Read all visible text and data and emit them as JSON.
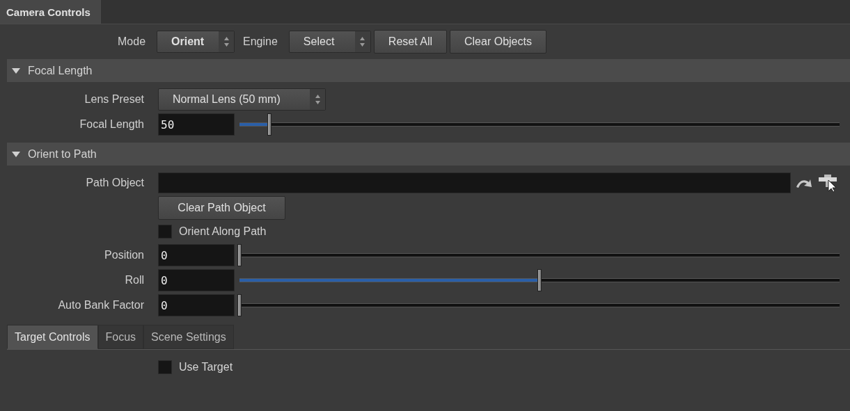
{
  "panel_tab": {
    "label": "Camera Controls",
    "selected": true
  },
  "toolbar": {
    "mode": {
      "label": "Mode",
      "value": "Orient"
    },
    "engine": {
      "label": "Engine",
      "value": "Select"
    },
    "buttons": [
      "Reset All",
      "Clear Objects"
    ]
  },
  "sections": [
    {
      "title": "Focal Length",
      "expanded": true,
      "rows": [
        {
          "kind": "dropdown",
          "label": "Lens Preset",
          "value": "Normal Lens (50 mm)"
        },
        {
          "kind": "slider",
          "label": "Focal Length",
          "value": "50",
          "level": 0.05
        }
      ]
    },
    {
      "title": "Orient to Path",
      "expanded": true,
      "rows": [
        {
          "kind": "object",
          "label": "Path Object"
        },
        {
          "kind": "button",
          "label": "Clear Path Object"
        },
        {
          "kind": "checkbox",
          "label": "Orient Along Path",
          "checked": false
        },
        {
          "kind": "slider",
          "label": "Position",
          "value": "0",
          "level": 0
        },
        {
          "kind": "slider",
          "label": "Roll",
          "value": "0",
          "level": 0.5
        },
        {
          "kind": "slider",
          "label": "Auto Bank Factor",
          "value": "0",
          "level": 0
        }
      ]
    }
  ],
  "tabs": [
    {
      "label": "Target Controls",
      "selected": true
    },
    {
      "label": "Focus",
      "selected": false
    },
    {
      "label": "Scene Settings",
      "selected": false
    }
  ],
  "tab_content": [
    {
      "kind": "checkbox",
      "label": "Use Target",
      "checked": false
    }
  ]
}
